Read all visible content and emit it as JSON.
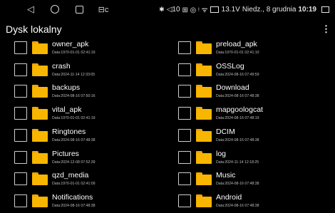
{
  "statusbar": {
    "nav_back_icon": "back-triangle-icon",
    "nav_home_icon": "home-circle-icon",
    "nav_recent_icon": "recent-square-icon",
    "usb_icon": "usb-icon",
    "bluetooth": "✱",
    "volume": "◁10",
    "signal_icons": "⊞ ◎ ᵎ ᯤ",
    "voltage": "13.1V",
    "date": "Niedz., 8 grudnia",
    "time": "10:19"
  },
  "header": {
    "title": "Dysk lokalny",
    "menu_icon": "⋮"
  },
  "files": [
    {
      "name": "owner_apk",
      "date": "Data:1970-01-01 02:41:19"
    },
    {
      "name": "preload_apk",
      "date": "Data:1970-01-01 02:41:10"
    },
    {
      "name": "crash",
      "date": "Data:2024-11-14 12:33:05"
    },
    {
      "name": "OSSLog",
      "date": "Data:2024-08-16 07:49:59"
    },
    {
      "name": "backups",
      "date": "Data:2024-08-16 07:50:16"
    },
    {
      "name": "Download",
      "date": "Data:2024-08-16 07:48:38"
    },
    {
      "name": "vital_apk",
      "date": "Data:1970-01-01 02:41:19"
    },
    {
      "name": "mapgoologcat",
      "date": "Data:2024-08-16 07:48:19"
    },
    {
      "name": "Ringtones",
      "date": "Data:2024-08-16 07:48:38"
    },
    {
      "name": "DCIM",
      "date": "Data:2024-08-16 07:48:38"
    },
    {
      "name": "Pictures",
      "date": "Data:2024-12-08 07:52:39"
    },
    {
      "name": "log",
      "date": "Data:2024-11-14 12:18:25"
    },
    {
      "name": "qzd_media",
      "date": "Data:1970-01-01 02:41:09"
    },
    {
      "name": "Music",
      "date": "Data:2024-08-16 07:48:38"
    },
    {
      "name": "Notifications",
      "date": "Data:2024-08-16 07:48:38"
    },
    {
      "name": "Android",
      "date": "Data:2024-08-16 07:48:38"
    }
  ]
}
